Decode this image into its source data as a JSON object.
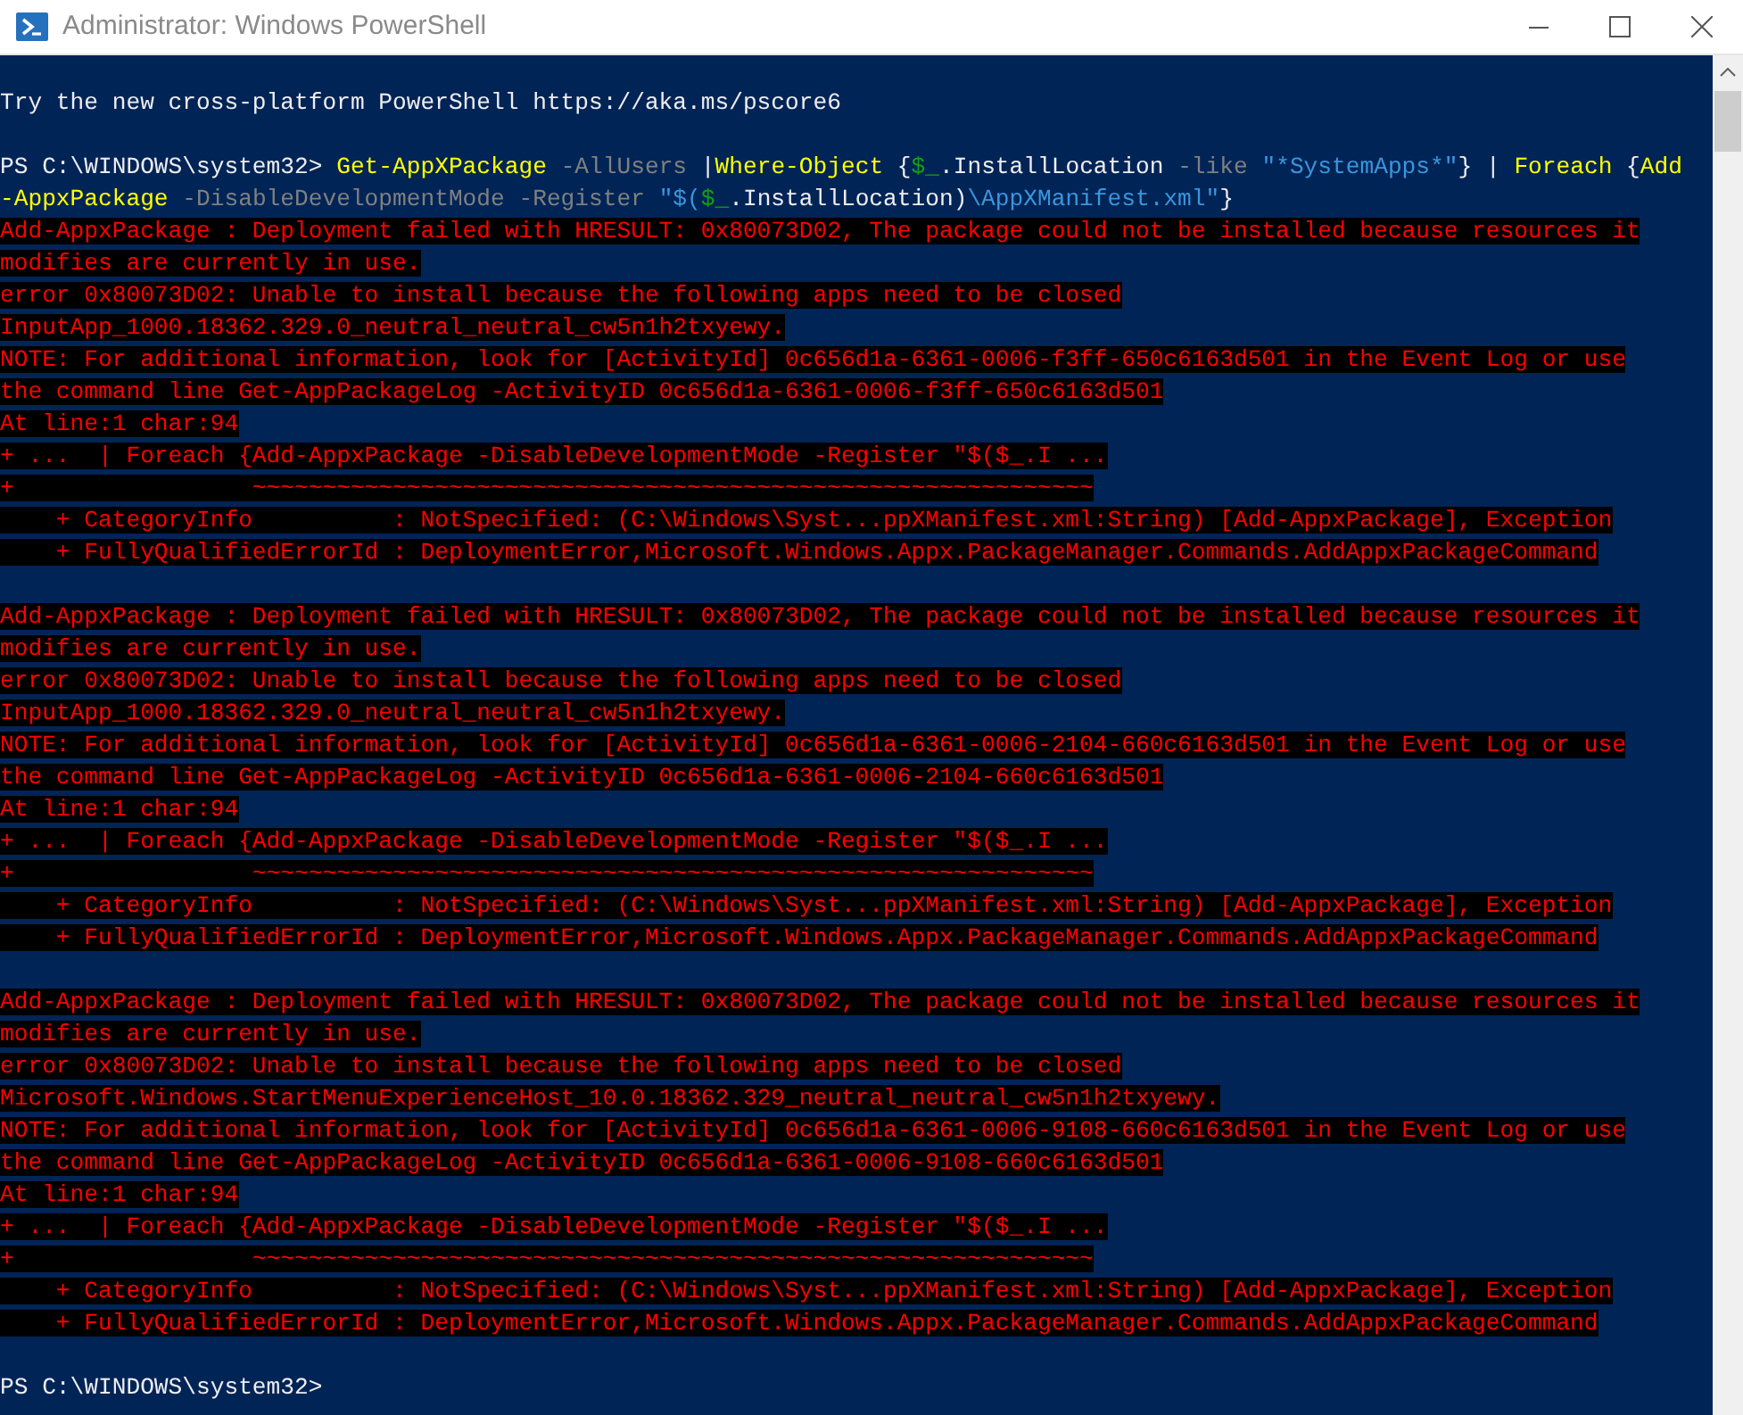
{
  "window": {
    "title": "Administrator: Windows PowerShell"
  },
  "console": {
    "lines": [
      {
        "kind": "blank"
      },
      {
        "kind": "output",
        "text": "Try the new cross-platform PowerShell https://aka.ms/pscore6"
      },
      {
        "kind": "blank"
      },
      {
        "kind": "command",
        "segments": [
          {
            "kind": "plain",
            "text": "PS C:\\WINDOWS\\system32> "
          },
          {
            "kind": "cmdlet",
            "text": "Get-AppXPackage"
          },
          {
            "kind": "parameter",
            "text": " -AllUsers "
          },
          {
            "kind": "plain",
            "text": "|"
          },
          {
            "kind": "cmdlet",
            "text": "Where-Object"
          },
          {
            "kind": "plain",
            "text": " {"
          },
          {
            "kind": "variable",
            "text": "$_"
          },
          {
            "kind": "plain",
            "text": ".InstallLocation "
          },
          {
            "kind": "parameter",
            "text": "-like "
          },
          {
            "kind": "string",
            "text": "\"*SystemApps*\""
          },
          {
            "kind": "plain",
            "text": "} | "
          },
          {
            "kind": "cmdlet",
            "text": "Foreach"
          },
          {
            "kind": "plain",
            "text": " {"
          },
          {
            "kind": "cmdlet",
            "text": "Add"
          }
        ]
      },
      {
        "kind": "command",
        "segments": [
          {
            "kind": "cmdlet",
            "text": "-AppxPackage"
          },
          {
            "kind": "parameter",
            "text": " -DisableDevelopmentMode -Register "
          },
          {
            "kind": "string",
            "text": "\"$("
          },
          {
            "kind": "variable",
            "text": "$_"
          },
          {
            "kind": "plain",
            "text": ".InstallLocation)"
          },
          {
            "kind": "string",
            "text": "\\AppXManifest.xml\""
          },
          {
            "kind": "plain",
            "text": "}"
          }
        ]
      },
      {
        "kind": "error",
        "text": "Add-AppxPackage : Deployment failed with HRESULT: 0x80073D02, The package could not be installed because resources it"
      },
      {
        "kind": "error",
        "text": "modifies are currently in use."
      },
      {
        "kind": "error",
        "text": "error 0x80073D02: Unable to install because the following apps need to be closed"
      },
      {
        "kind": "error",
        "text": "InputApp_1000.18362.329.0_neutral_neutral_cw5n1h2txyewy."
      },
      {
        "kind": "error",
        "text": "NOTE: For additional information, look for [ActivityId] 0c656d1a-6361-0006-f3ff-650c6163d501 in the Event Log or use"
      },
      {
        "kind": "error",
        "text": "the command line Get-AppPackageLog -ActivityID 0c656d1a-6361-0006-f3ff-650c6163d501"
      },
      {
        "kind": "error",
        "text": "At line:1 char:94"
      },
      {
        "kind": "error",
        "text": "+ ...  | Foreach {Add-AppxPackage -DisableDevelopmentMode -Register \"$($_.I ..."
      },
      {
        "kind": "error",
        "text": "+                 ~~~~~~~~~~~~~~~~~~~~~~~~~~~~~~~~~~~~~~~~~~~~~~~~~~~~~~~~~~~~"
      },
      {
        "kind": "error",
        "text": "    + CategoryInfo          : NotSpecified: (C:\\Windows\\Syst...ppXManifest.xml:String) [Add-AppxPackage], Exception"
      },
      {
        "kind": "error",
        "text": "    + FullyQualifiedErrorId : DeploymentError,Microsoft.Windows.Appx.PackageManager.Commands.AddAppxPackageCommand"
      },
      {
        "kind": "blank"
      },
      {
        "kind": "error",
        "text": "Add-AppxPackage : Deployment failed with HRESULT: 0x80073D02, The package could not be installed because resources it"
      },
      {
        "kind": "error",
        "text": "modifies are currently in use."
      },
      {
        "kind": "error",
        "text": "error 0x80073D02: Unable to install because the following apps need to be closed"
      },
      {
        "kind": "error",
        "text": "InputApp_1000.18362.329.0_neutral_neutral_cw5n1h2txyewy."
      },
      {
        "kind": "error",
        "text": "NOTE: For additional information, look for [ActivityId] 0c656d1a-6361-0006-2104-660c6163d501 in the Event Log or use"
      },
      {
        "kind": "error",
        "text": "the command line Get-AppPackageLog -ActivityID 0c656d1a-6361-0006-2104-660c6163d501"
      },
      {
        "kind": "error",
        "text": "At line:1 char:94"
      },
      {
        "kind": "error",
        "text": "+ ...  | Foreach {Add-AppxPackage -DisableDevelopmentMode -Register \"$($_.I ..."
      },
      {
        "kind": "error",
        "text": "+                 ~~~~~~~~~~~~~~~~~~~~~~~~~~~~~~~~~~~~~~~~~~~~~~~~~~~~~~~~~~~~"
      },
      {
        "kind": "error",
        "text": "    + CategoryInfo          : NotSpecified: (C:\\Windows\\Syst...ppXManifest.xml:String) [Add-AppxPackage], Exception"
      },
      {
        "kind": "error",
        "text": "    + FullyQualifiedErrorId : DeploymentError,Microsoft.Windows.Appx.PackageManager.Commands.AddAppxPackageCommand"
      },
      {
        "kind": "blank"
      },
      {
        "kind": "error",
        "text": "Add-AppxPackage : Deployment failed with HRESULT: 0x80073D02, The package could not be installed because resources it"
      },
      {
        "kind": "error",
        "text": "modifies are currently in use."
      },
      {
        "kind": "error",
        "text": "error 0x80073D02: Unable to install because the following apps need to be closed"
      },
      {
        "kind": "error",
        "text": "Microsoft.Windows.StartMenuExperienceHost_10.0.18362.329_neutral_neutral_cw5n1h2txyewy."
      },
      {
        "kind": "error",
        "text": "NOTE: For additional information, look for [ActivityId] 0c656d1a-6361-0006-9108-660c6163d501 in the Event Log or use"
      },
      {
        "kind": "error",
        "text": "the command line Get-AppPackageLog -ActivityID 0c656d1a-6361-0006-9108-660c6163d501"
      },
      {
        "kind": "error",
        "text": "At line:1 char:94"
      },
      {
        "kind": "error",
        "text": "+ ...  | Foreach {Add-AppxPackage -DisableDevelopmentMode -Register \"$($_.I ..."
      },
      {
        "kind": "error",
        "text": "+                 ~~~~~~~~~~~~~~~~~~~~~~~~~~~~~~~~~~~~~~~~~~~~~~~~~~~~~~~~~~~~"
      },
      {
        "kind": "error",
        "text": "    + CategoryInfo          : NotSpecified: (C:\\Windows\\Syst...ppXManifest.xml:String) [Add-AppxPackage], Exception"
      },
      {
        "kind": "error",
        "text": "    + FullyQualifiedErrorId : DeploymentError,Microsoft.Windows.Appx.PackageManager.Commands.AddAppxPackageCommand"
      },
      {
        "kind": "blank"
      },
      {
        "kind": "output",
        "text": "PS C:\\WINDOWS\\system32>"
      }
    ]
  }
}
